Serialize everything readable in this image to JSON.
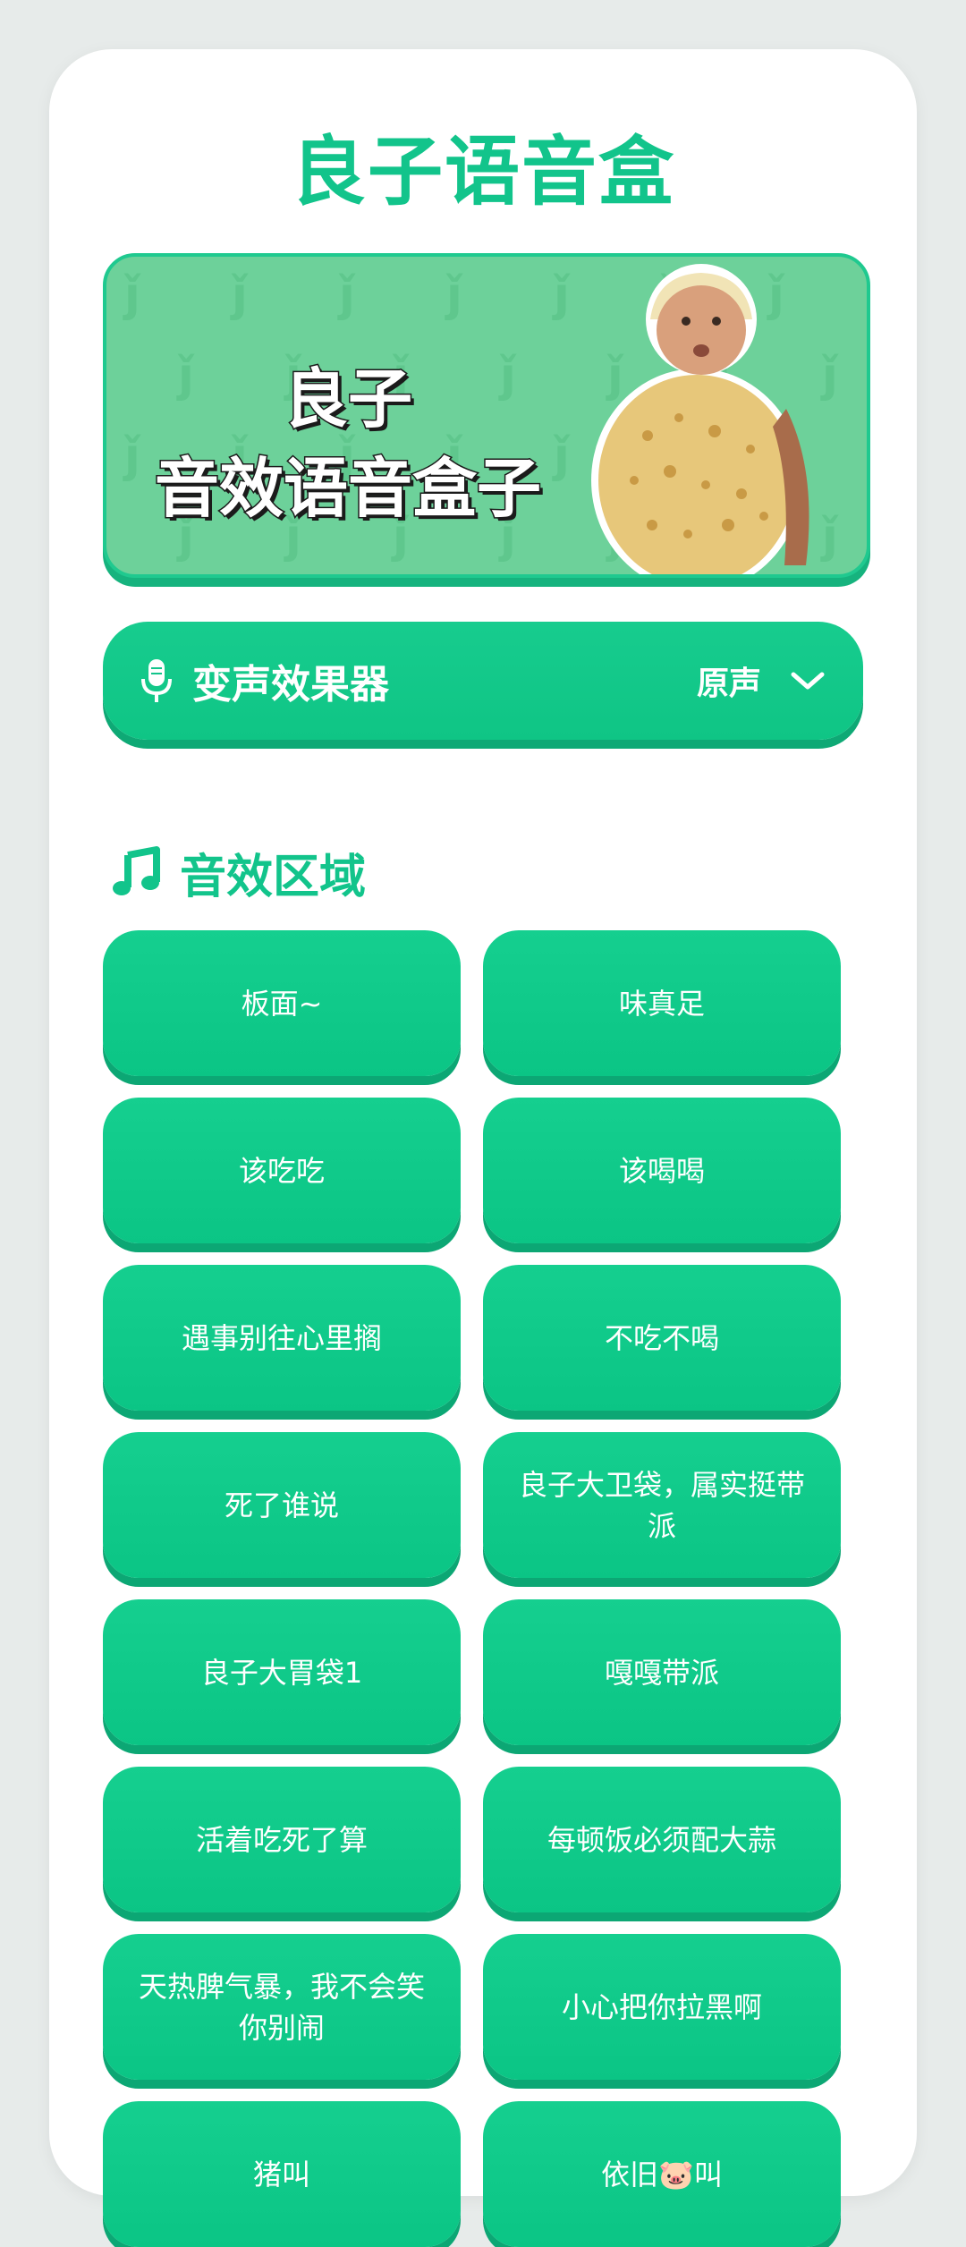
{
  "app": {
    "title": "良子语音盒"
  },
  "banner": {
    "line1": "良子",
    "line2": "音效语音盒子"
  },
  "voice_changer": {
    "label": "变声效果器",
    "value": "原声"
  },
  "sound_section": {
    "title": "音效区域"
  },
  "colors": {
    "accent": "#12c48b",
    "button": "#0fc585",
    "banner_bg": "#6dd19a"
  },
  "icons": {
    "mic": "mic-icon",
    "chevron": "chevron-down-icon",
    "music": "music-note-icon"
  },
  "sounds": [
    {
      "label": "板面~"
    },
    {
      "label": "味真足"
    },
    {
      "label": "该吃吃"
    },
    {
      "label": "该喝喝"
    },
    {
      "label": "遇事别往心里搁"
    },
    {
      "label": "不吃不喝"
    },
    {
      "label": "死了谁说"
    },
    {
      "label": "良子大卫袋，属实挺带派"
    },
    {
      "label": "良子大胃袋1"
    },
    {
      "label": "嘎嘎带派"
    },
    {
      "label": "活着吃死了算"
    },
    {
      "label": "每顿饭必须配大蒜"
    },
    {
      "label": "天热脾气暴，我不会笑你别闹"
    },
    {
      "label": "小心把你拉黑啊"
    },
    {
      "label": "猪叫"
    },
    {
      "label": "依旧🐷叫"
    }
  ]
}
